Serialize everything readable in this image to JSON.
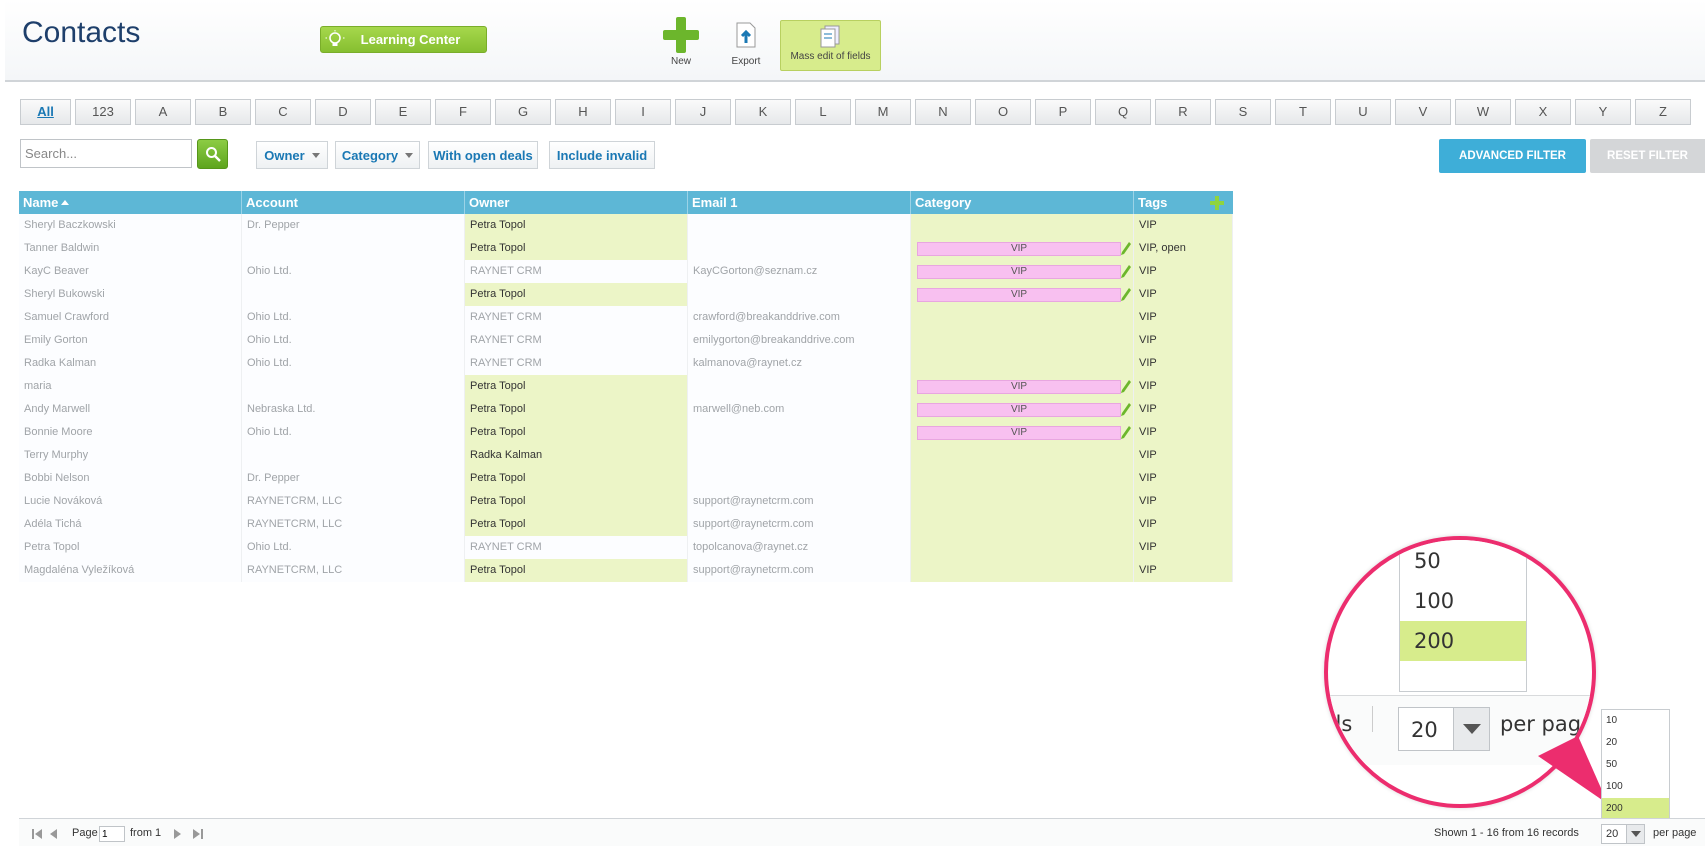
{
  "header": {
    "title": "Contacts",
    "learning_center": "Learning Center",
    "toolbar": {
      "new": "New",
      "export": "Export",
      "mass_edit": "Mass edit of fields"
    }
  },
  "alphabet": [
    "All",
    "123",
    "A",
    "B",
    "C",
    "D",
    "E",
    "F",
    "G",
    "H",
    "I",
    "J",
    "K",
    "L",
    "M",
    "N",
    "O",
    "P",
    "Q",
    "R",
    "S",
    "T",
    "U",
    "V",
    "W",
    "X",
    "Y",
    "Z"
  ],
  "filters": {
    "search_placeholder": "Search...",
    "owner": "Owner",
    "category": "Category",
    "with_open_deals": "With open deals",
    "include_invalid": "Include invalid",
    "advanced": "ADVANCED FILTER",
    "reset": "RESET FILTER"
  },
  "table": {
    "columns": [
      "Name",
      "Account",
      "Owner",
      "Email 1",
      "Category",
      "Tags"
    ],
    "rows": [
      {
        "name": "Sheryl Baczkowski",
        "account": "Dr. Pepper",
        "owner": "Petra Topol",
        "email": "",
        "category": "",
        "tags": "VIP"
      },
      {
        "name": "Tanner Baldwin",
        "account": "",
        "owner": "Petra Topol",
        "email": "",
        "category": "VIP",
        "tags": "VIP, open"
      },
      {
        "name": "KayC Beaver",
        "account": "Ohio Ltd.",
        "owner": "RAYNET CRM",
        "email": "KayCGorton@seznam.cz",
        "category": "VIP",
        "tags": "VIP"
      },
      {
        "name": "Sheryl Bukowski",
        "account": "",
        "owner": "Petra Topol",
        "email": "",
        "category": "VIP",
        "tags": "VIP"
      },
      {
        "name": "Samuel Crawford",
        "account": "Ohio Ltd.",
        "owner": "RAYNET CRM",
        "email": "crawford@breakanddrive.com",
        "category": "",
        "tags": "VIP"
      },
      {
        "name": "Emily Gorton",
        "account": "Ohio Ltd.",
        "owner": "RAYNET CRM",
        "email": "emilygorton@breakanddrive.com",
        "category": "",
        "tags": "VIP"
      },
      {
        "name": "Radka Kalman",
        "account": "Ohio Ltd.",
        "owner": "RAYNET CRM",
        "email": "kalmanova@raynet.cz",
        "category": "",
        "tags": "VIP"
      },
      {
        "name": "maria",
        "account": "",
        "owner": "Petra Topol",
        "email": "",
        "category": "VIP",
        "tags": "VIP"
      },
      {
        "name": "Andy Marwell",
        "account": "Nebraska Ltd.",
        "owner": "Petra Topol",
        "email": "marwell@neb.com",
        "category": "VIP",
        "tags": "VIP"
      },
      {
        "name": "Bonnie Moore",
        "account": "Ohio Ltd.",
        "owner": "Petra Topol",
        "email": "",
        "category": "VIP",
        "tags": "VIP"
      },
      {
        "name": "Terry Murphy",
        "account": "",
        "owner": "Radka Kalman",
        "email": "",
        "category": "",
        "tags": "VIP"
      },
      {
        "name": "Bobbi Nelson",
        "account": "Dr. Pepper",
        "owner": "Petra Topol",
        "email": "",
        "category": "",
        "tags": "VIP"
      },
      {
        "name": "Lucie Nováková",
        "account": "RAYNETCRM, LLC",
        "owner": "Petra Topol",
        "email": "support@raynetcrm.com",
        "category": "",
        "tags": "VIP"
      },
      {
        "name": "Adéla Tichá",
        "account": "RAYNETCRM, LLC",
        "owner": "Petra Topol",
        "email": "support@raynetcrm.com",
        "category": "",
        "tags": "VIP"
      },
      {
        "name": "Petra Topol",
        "account": "Ohio Ltd.",
        "owner": "RAYNET CRM",
        "email": "topolcanova@raynet.cz",
        "category": "",
        "tags": "VIP"
      },
      {
        "name": "Magdaléna Vyležíková",
        "account": "RAYNETCRM, LLC",
        "owner": "Petra Topol",
        "email": "support@raynetcrm.com",
        "category": "",
        "tags": "VIP"
      }
    ]
  },
  "magnifier": {
    "options": [
      "50",
      "100",
      "200"
    ],
    "selected": "200",
    "records_fragment": "ds",
    "value": "20",
    "per_page": "per page"
  },
  "per_page_dropdown": {
    "options": [
      "10",
      "20",
      "50",
      "100",
      "200"
    ],
    "selected": "200"
  },
  "footer": {
    "page_label": "Page",
    "page_value": "1",
    "from_label": "from 1",
    "shown": "Shown 1 - 16 from 16 records",
    "per_page_value": "20",
    "per_page_label": "per page"
  },
  "colors": {
    "header_blue": "#5db7d6",
    "highlight_green": "#ecf5c7",
    "vip_pink": "#f8c0f0",
    "accent_pink": "#ec2d6e",
    "primary_green": "#86bf30"
  }
}
